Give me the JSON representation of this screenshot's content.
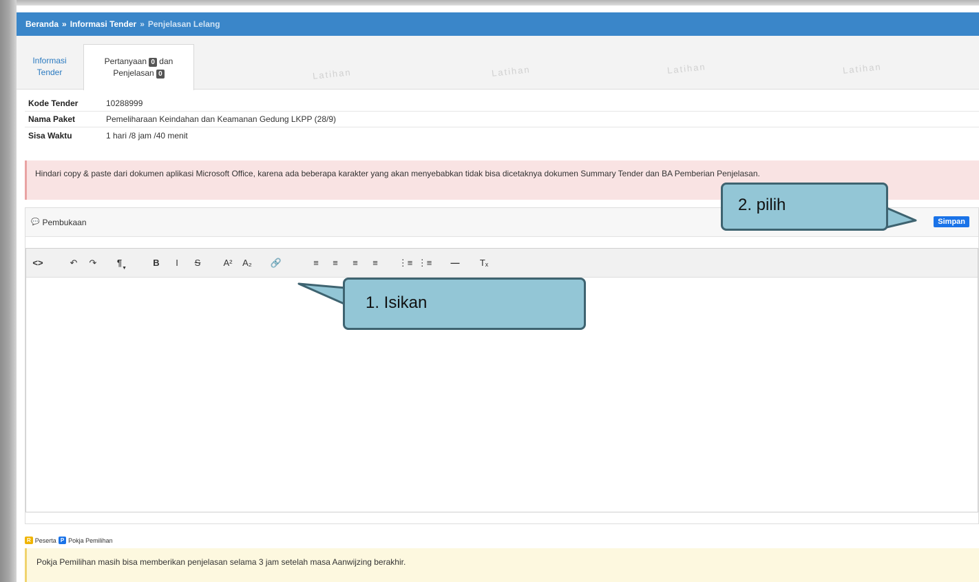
{
  "breadcrumb": {
    "home": "Beranda",
    "separator": "»",
    "section": "Informasi Tender",
    "current": "Penjelasan Lelang"
  },
  "tabs": {
    "info_line1": "Informasi",
    "info_line2": "Tender",
    "qa_line1_pre": "Pertanyaan",
    "qa_count": "0",
    "qa_line1_post": "dan",
    "qa_line2_pre": "Penjelasan",
    "qa_count2": "0"
  },
  "watermark": "Latihan",
  "details": [
    {
      "label": "Kode Tender",
      "value": "10288999"
    },
    {
      "label": "Nama Paket",
      "value": "Pemeliharaan Keindahan dan Keamanan Gedung LKPP (28/9)"
    },
    {
      "label": "Sisa Waktu",
      "value": "1 hari /8 jam /40 menit"
    }
  ],
  "warning": "Hindari copy & paste dari dokumen aplikasi Microsoft Office, karena ada beberapa karakter yang akan menyebabkan tidak bisa dicetaknya dokumen Summary Tender dan BA Pemberian Penjelasan.",
  "panel": {
    "title": "Pembukaan",
    "save_label": "Simpan"
  },
  "legend": {
    "r_badge": "R",
    "r_label": "Peserta",
    "p_badge": "P",
    "p_label": "Pokja Pemilihan"
  },
  "notice": "Pokja Pemilihan masih bisa memberikan penjelasan selama 3 jam setelah masa Aanwijzing berakhir.",
  "callouts": {
    "step1": "1.  Isikan",
    "step2": "2. pilih"
  },
  "colors": {
    "breadcrumb_bg": "#3a86c9",
    "save_button": "#1a73e8",
    "callout_fill": "#93c6d6",
    "callout_border": "#3e6370"
  }
}
